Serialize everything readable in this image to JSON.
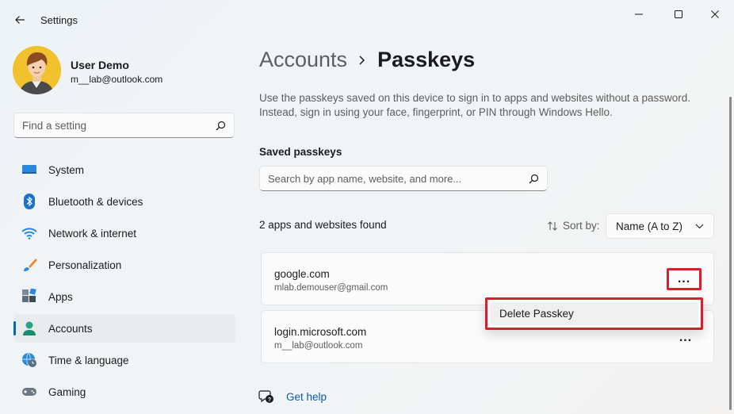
{
  "window": {
    "title": "Settings",
    "icons": {
      "back": "arrow-left-icon",
      "minimize": "minimize-icon",
      "maximize": "maximize-icon",
      "close": "close-icon"
    }
  },
  "profile": {
    "name": "User Demo",
    "email": "m__lab@outlook.com"
  },
  "sidebar": {
    "search_placeholder": "Find a setting",
    "items": [
      {
        "label": "System",
        "icon": "monitor-icon",
        "active": false
      },
      {
        "label": "Bluetooth & devices",
        "icon": "bluetooth-icon",
        "active": false
      },
      {
        "label": "Network & internet",
        "icon": "wifi-icon",
        "active": false
      },
      {
        "label": "Personalization",
        "icon": "brush-icon",
        "active": false
      },
      {
        "label": "Apps",
        "icon": "apps-icon",
        "active": false
      },
      {
        "label": "Accounts",
        "icon": "person-icon",
        "active": true
      },
      {
        "label": "Time & language",
        "icon": "globe-clock-icon",
        "active": false
      },
      {
        "label": "Gaming",
        "icon": "gamepad-icon",
        "active": false
      }
    ]
  },
  "main": {
    "breadcrumb_parent": "Accounts",
    "breadcrumb_current": "Passkeys",
    "description": "Use the passkeys saved on this device to sign in to apps and websites without a password. Instead, sign in using your face, fingerprint, or PIN through Windows Hello.",
    "section_title": "Saved passkeys",
    "search_placeholder": "Search by app name, website, and more...",
    "found_text": "2 apps and websites found",
    "sort_label": "Sort by:",
    "sort_value": "Name (A to Z)",
    "passkeys": [
      {
        "site": "google.com",
        "user": "mlab.demouser@gmail.com"
      },
      {
        "site": "login.microsoft.com",
        "user": "m__lab@outlook.com"
      }
    ],
    "menu_item": "Delete Passkey",
    "more_label": "...",
    "help_label": "Get help"
  },
  "colors": {
    "accent": "#0067c0",
    "highlight": "#d7202e",
    "link": "#0a5aa8"
  }
}
